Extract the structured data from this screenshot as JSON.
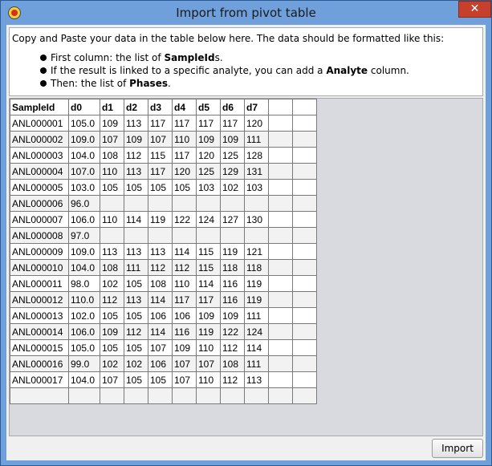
{
  "window": {
    "title": "Import from pivot table",
    "close_label": "✕",
    "icon": "app-icon"
  },
  "info": {
    "intro": "Copy and Paste your data in the table below here. The data should be formatted like this:",
    "bullets": [
      {
        "pre": "First column: the list of ",
        "bold": "SampleId",
        "post": "s."
      },
      {
        "pre": "If the result is linked to a specific analyte, you can add a ",
        "bold": "Analyte",
        "post": " column."
      },
      {
        "pre": "Then: the list of ",
        "bold": "Phases",
        "post": "."
      }
    ]
  },
  "table": {
    "headers": [
      "SampleId",
      "d0",
      "d1",
      "d2",
      "d3",
      "d4",
      "d5",
      "d6",
      "d7",
      "",
      ""
    ],
    "rows": [
      [
        "ANL000001",
        "105.0",
        "109",
        "113",
        "117",
        "117",
        "117",
        "117",
        "120",
        "",
        ""
      ],
      [
        "ANL000002",
        "109.0",
        "107",
        "109",
        "107",
        "110",
        "109",
        "109",
        "111",
        "",
        ""
      ],
      [
        "ANL000003",
        "104.0",
        "108",
        "112",
        "115",
        "117",
        "120",
        "125",
        "128",
        "",
        ""
      ],
      [
        "ANL000004",
        "107.0",
        "110",
        "113",
        "117",
        "120",
        "125",
        "129",
        "131",
        "",
        ""
      ],
      [
        "ANL000005",
        "103.0",
        "105",
        "105",
        "105",
        "105",
        "103",
        "102",
        "103",
        "",
        ""
      ],
      [
        "ANL000006",
        "96.0",
        "",
        "",
        "",
        "",
        "",
        "",
        "",
        "",
        ""
      ],
      [
        "ANL000007",
        "106.0",
        "110",
        "114",
        "119",
        "122",
        "124",
        "127",
        "130",
        "",
        ""
      ],
      [
        "ANL000008",
        "97.0",
        "",
        "",
        "",
        "",
        "",
        "",
        "",
        "",
        ""
      ],
      [
        "ANL000009",
        "109.0",
        "113",
        "113",
        "113",
        "114",
        "115",
        "119",
        "121",
        "",
        ""
      ],
      [
        "ANL000010",
        "104.0",
        "108",
        "111",
        "112",
        "112",
        "115",
        "118",
        "118",
        "",
        ""
      ],
      [
        "ANL000011",
        "98.0",
        "102",
        "105",
        "108",
        "110",
        "114",
        "116",
        "119",
        "",
        ""
      ],
      [
        "ANL000012",
        "110.0",
        "112",
        "113",
        "114",
        "117",
        "117",
        "116",
        "119",
        "",
        ""
      ],
      [
        "ANL000013",
        "102.0",
        "105",
        "105",
        "106",
        "106",
        "109",
        "109",
        "111",
        "",
        ""
      ],
      [
        "ANL000014",
        "106.0",
        "109",
        "112",
        "114",
        "116",
        "119",
        "122",
        "124",
        "",
        ""
      ],
      [
        "ANL000015",
        "105.0",
        "105",
        "105",
        "107",
        "109",
        "110",
        "112",
        "114",
        "",
        ""
      ],
      [
        "ANL000016",
        "99.0",
        "102",
        "102",
        "106",
        "107",
        "107",
        "108",
        "111",
        "",
        ""
      ],
      [
        "ANL000017",
        "104.0",
        "107",
        "105",
        "105",
        "107",
        "110",
        "112",
        "113",
        "",
        ""
      ],
      [
        "",
        "",
        "",
        "",
        "",
        "",
        "",
        "",
        "",
        "",
        ""
      ]
    ],
    "selected_cell": {
      "row": 3,
      "col": 10
    }
  },
  "footer": {
    "import_label": "Import"
  }
}
